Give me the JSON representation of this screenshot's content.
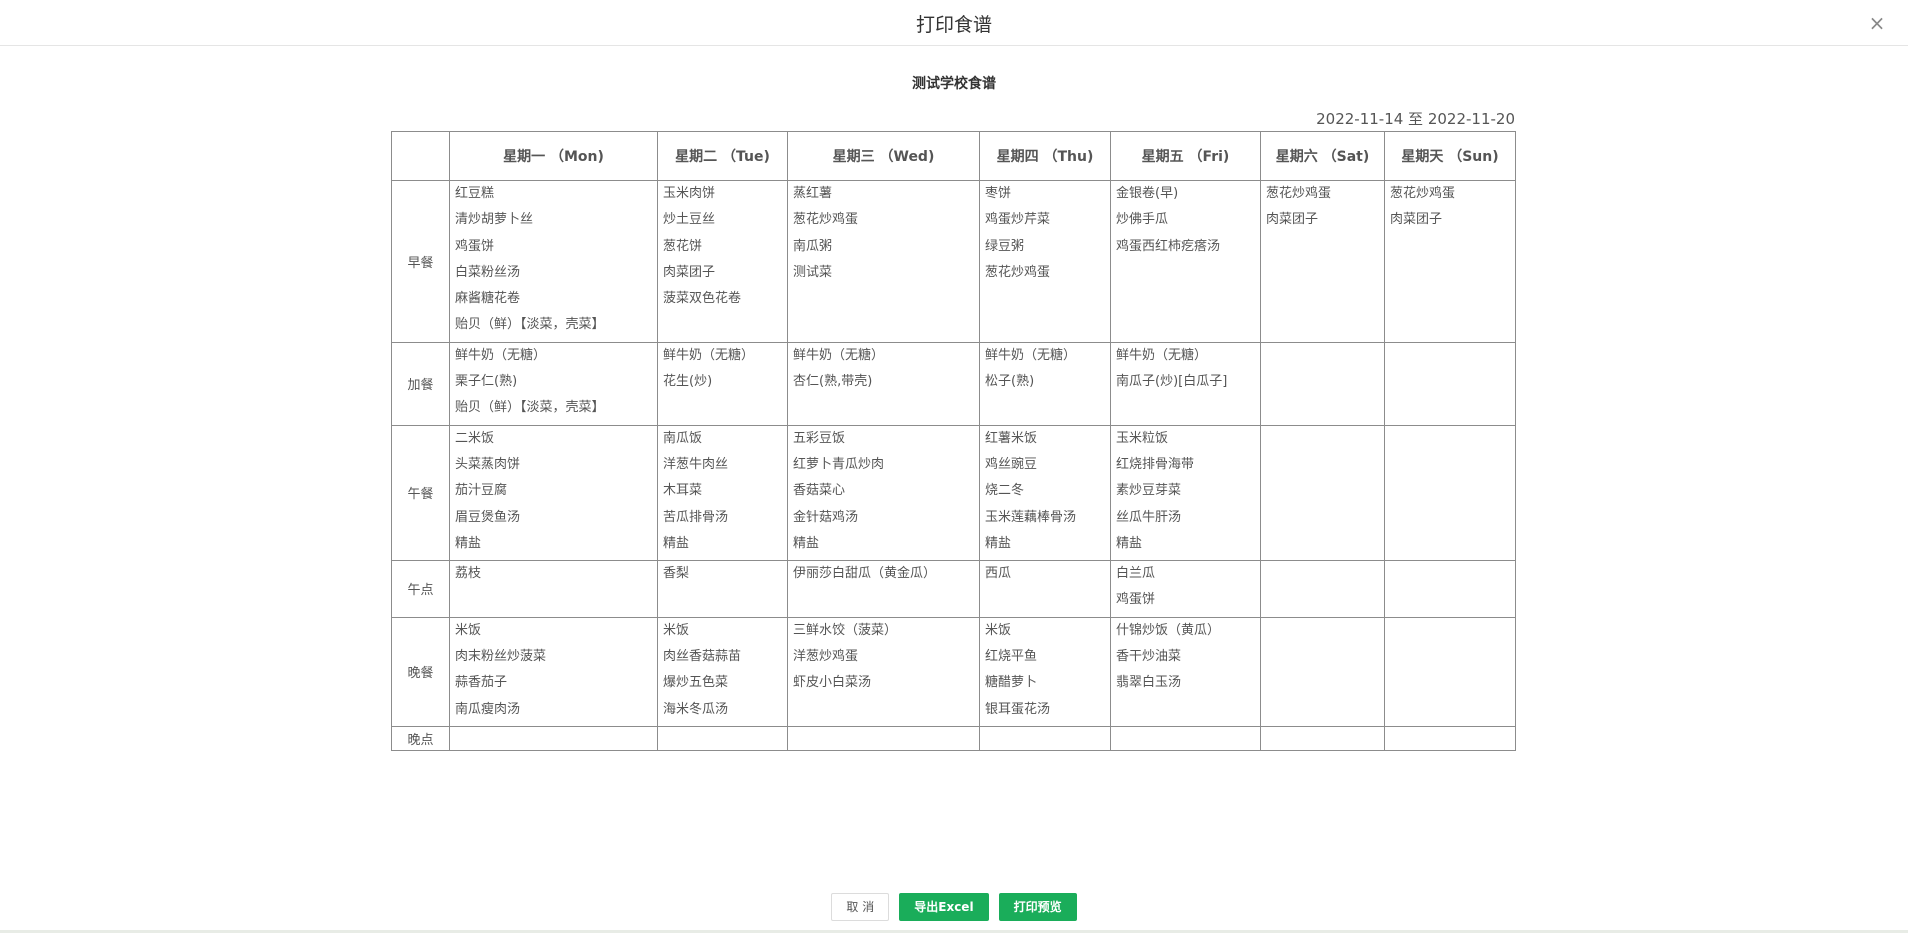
{
  "dialog": {
    "title": "打印食谱",
    "close_symbol": "×"
  },
  "print": {
    "title": "测试学校食谱",
    "date_range": "2022-11-14 至 2022-11-20"
  },
  "table": {
    "headers": [
      "",
      "星期一 （Mon)",
      "星期二 （Tue)",
      "星期三 （Wed)",
      "星期四 （Thu)",
      "星期五 （Fri)",
      "星期六 （Sat)",
      "星期天 （Sun)"
    ],
    "rows": [
      {
        "meal": "早餐",
        "days": [
          [
            "红豆糕",
            "清炒胡萝卜丝",
            "鸡蛋饼",
            "白菜粉丝汤",
            "麻酱糖花卷",
            "贻贝（鲜）【淡菜，壳菜】"
          ],
          [
            "玉米肉饼",
            "炒土豆丝",
            "葱花饼",
            "肉菜团子",
            "菠菜双色花卷"
          ],
          [
            "蒸红薯",
            "葱花炒鸡蛋",
            "南瓜粥",
            "测试菜"
          ],
          [
            "枣饼",
            "鸡蛋炒芹菜",
            "绿豆粥",
            "葱花炒鸡蛋"
          ],
          [
            "金银卷(早)",
            "炒佛手瓜",
            "鸡蛋西红柿疙瘩汤"
          ],
          [
            "葱花炒鸡蛋",
            "肉菜团子"
          ],
          [
            "葱花炒鸡蛋",
            "肉菜团子"
          ]
        ]
      },
      {
        "meal": "加餐",
        "days": [
          [
            "鲜牛奶（无糖）",
            "栗子仁(熟)",
            "贻贝（鲜）【淡菜，壳菜】"
          ],
          [
            "鲜牛奶（无糖）",
            "花生(炒)"
          ],
          [
            "鲜牛奶（无糖）",
            "杏仁(熟,带壳)"
          ],
          [
            "鲜牛奶（无糖）",
            "松子(熟)"
          ],
          [
            "鲜牛奶（无糖）",
            "南瓜子(炒)[白瓜子]"
          ],
          [],
          []
        ]
      },
      {
        "meal": "午餐",
        "days": [
          [
            "二米饭",
            "头菜蒸肉饼",
            "茄汁豆腐",
            "眉豆煲鱼汤",
            "精盐"
          ],
          [
            "南瓜饭",
            "洋葱牛肉丝",
            "木耳菜",
            "苦瓜排骨汤",
            "精盐"
          ],
          [
            "五彩豆饭",
            "红萝卜青瓜炒肉",
            "香菇菜心",
            "金针菇鸡汤",
            "精盐"
          ],
          [
            "红薯米饭",
            "鸡丝豌豆",
            "烧二冬",
            "玉米莲藕棒骨汤",
            "精盐"
          ],
          [
            "玉米粒饭",
            "红烧排骨海带",
            "素炒豆芽菜",
            "丝瓜牛肝汤",
            "精盐"
          ],
          [],
          []
        ]
      },
      {
        "meal": "午点",
        "days": [
          [
            "荔枝"
          ],
          [
            "香梨"
          ],
          [
            "伊丽莎白甜瓜（黄金瓜）"
          ],
          [
            "西瓜"
          ],
          [
            "白兰瓜",
            "鸡蛋饼"
          ],
          [],
          []
        ]
      },
      {
        "meal": "晚餐",
        "days": [
          [
            "米饭",
            "肉末粉丝炒菠菜",
            "蒜香茄子",
            "南瓜瘦肉汤"
          ],
          [
            "米饭",
            "肉丝香菇蒜苗",
            "爆炒五色菜",
            "海米冬瓜汤"
          ],
          [
            "三鲜水饺（菠菜）",
            "洋葱炒鸡蛋",
            "虾皮小白菜汤"
          ],
          [
            "米饭",
            "红烧平鱼",
            "糖醋萝卜",
            "银耳蛋花汤"
          ],
          [
            "什锦炒饭（黄瓜）",
            "香干炒油菜",
            "翡翠白玉汤"
          ],
          [],
          []
        ]
      },
      {
        "meal": "晚点",
        "days": [
          [],
          [],
          [],
          [],
          [],
          [],
          []
        ]
      }
    ]
  },
  "footer": {
    "cancel_label": "取 消",
    "export_label": "导出Excel",
    "preview_label": "打印预览"
  }
}
